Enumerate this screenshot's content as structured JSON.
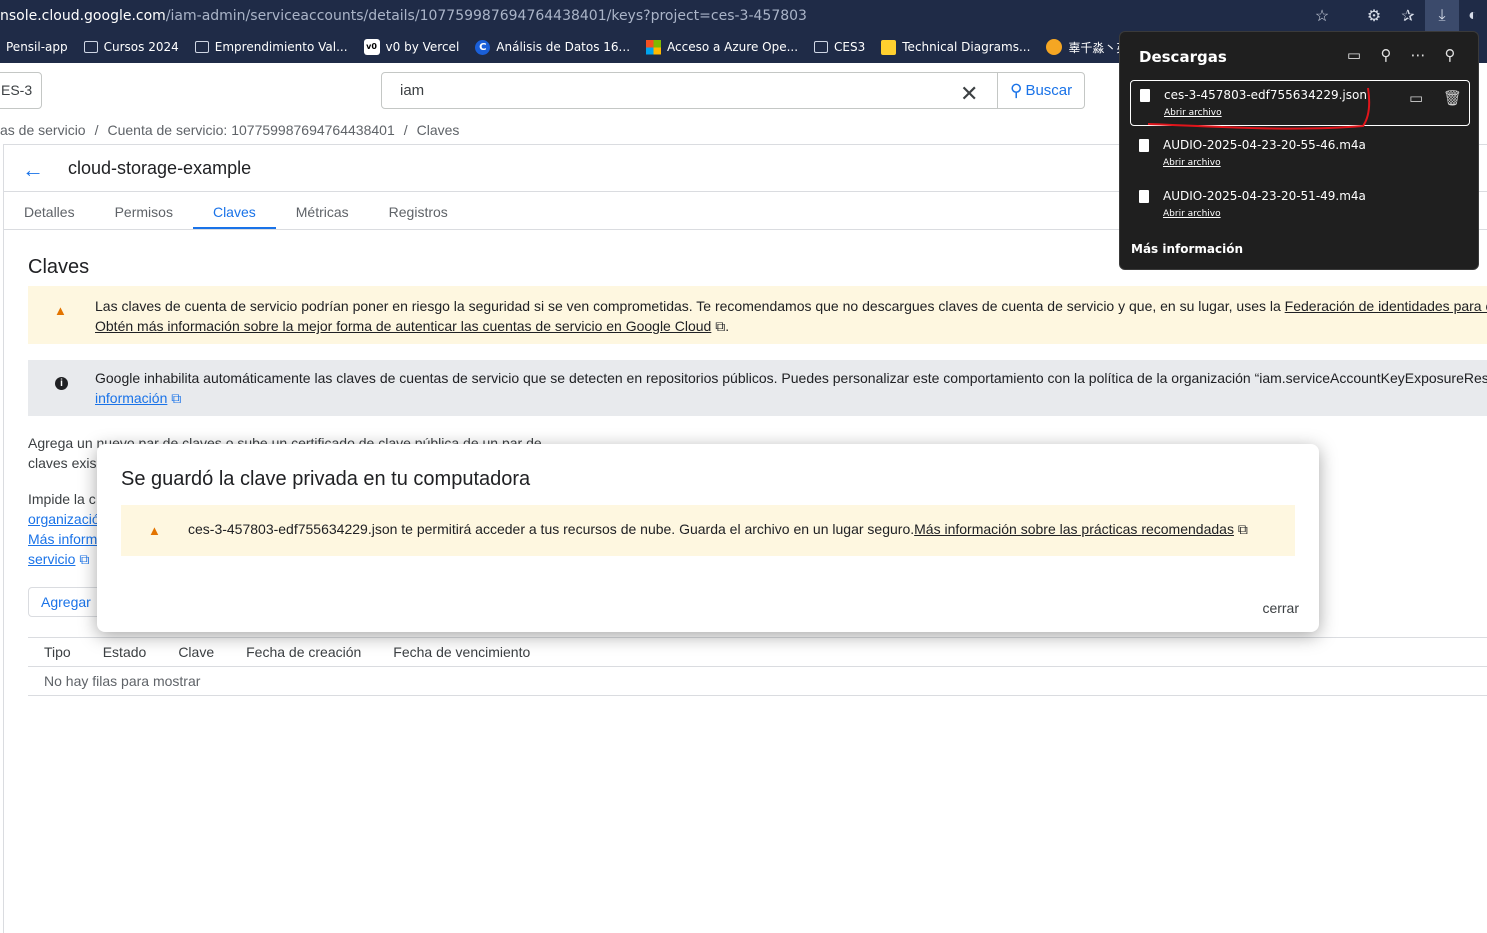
{
  "browser": {
    "url_host": "nsole.cloud.google.com",
    "url_path": "/iam-admin/serviceaccounts/details/107759987694764438401/keys?project=ces-3-457803",
    "bookmarks": [
      {
        "label": "Pensil-app",
        "icon": "none"
      },
      {
        "label": "Cursos 2024",
        "icon": "folder-icon"
      },
      {
        "label": "Emprendimiento Val...",
        "icon": "folder-icon"
      },
      {
        "label": "v0 by Vercel",
        "icon": "v0-icon"
      },
      {
        "label": "Análisis de Datos 16...",
        "icon": "c-icon"
      },
      {
        "label": "Acceso a Azure Ope...",
        "icon": "microsoft-icon"
      },
      {
        "label": "CES3",
        "icon": "folder-icon"
      },
      {
        "label": "Technical Diagrams...",
        "icon": "miro-icon"
      },
      {
        "label": "辜千淼丶英雄联盟...",
        "icon": "avatar-icon"
      }
    ]
  },
  "header": {
    "project_label": "ES-3",
    "search_value": "iam",
    "search_button": "Buscar"
  },
  "breadcrumb": [
    "as de servicio",
    "Cuenta de servicio: 107759987694764438401",
    "Claves"
  ],
  "page": {
    "title": "cloud-storage-example",
    "tabs": [
      "Detalles",
      "Permisos",
      "Claves",
      "Métricas",
      "Registros"
    ],
    "selected_tab": "Claves",
    "section_heading": "Claves",
    "warning": {
      "line1": "Las claves de cuenta de servicio podrían poner en riesgo la seguridad si se ven comprometidas. Te recomendamos que no descargues claves de cuenta de servicio y que, en su lugar, uses la ",
      "line1_link": "Federación de identidades para ca",
      "line2_link": "Obtén más información sobre la mejor forma de autenticar las cuentas de servicio en Google Cloud",
      "line2_end": "."
    },
    "info": {
      "line1": "Google inhabilita automáticamente las claves de cuentas de servicio que se detecten en repositorios públicos. Puedes personalizar este comportamiento con la política de la organización “iam.serviceAccountKeyExposureRes",
      "line2_link": "información"
    },
    "para1": [
      "Agrega un nuevo par de claves o sube un certificado de clave pública de un par de",
      "claves exis"
    ],
    "para2": [
      "Impide la c",
      "organizació",
      "Más inform",
      "servicio"
    ],
    "add_button": "Agregar",
    "table": {
      "headers": [
        "Tipo",
        "Estado",
        "Clave",
        "Fecha de creación",
        "Fecha de vencimiento"
      ],
      "empty": "No hay filas para mostrar"
    }
  },
  "modal": {
    "title": "Se guardó la clave privada en tu computadora",
    "message": "ces-3-457803-edf755634229.json te permitirá acceder a tus recursos de nube. Guarda el archivo en un lugar seguro.",
    "link": "Más información sobre las prácticas recomendadas",
    "close": "cerrar"
  },
  "downloads": {
    "title": "Descargas",
    "items": [
      {
        "name": "ces-3-457803-edf755634229.json",
        "action": "Abrir archivo"
      },
      {
        "name": "AUDIO-2025-04-23-20-55-46.m4a",
        "action": "Abrir archivo"
      },
      {
        "name": "AUDIO-2025-04-23-20-51-49.m4a",
        "action": "Abrir archivo"
      }
    ],
    "more": "Más información"
  },
  "colors": {
    "accent": "#1a73e8",
    "warning_bg": "#fef7e0",
    "warning_icon": "#e37400",
    "browser_bar": "#1f2b47",
    "annotation_red": "#e0151b"
  }
}
